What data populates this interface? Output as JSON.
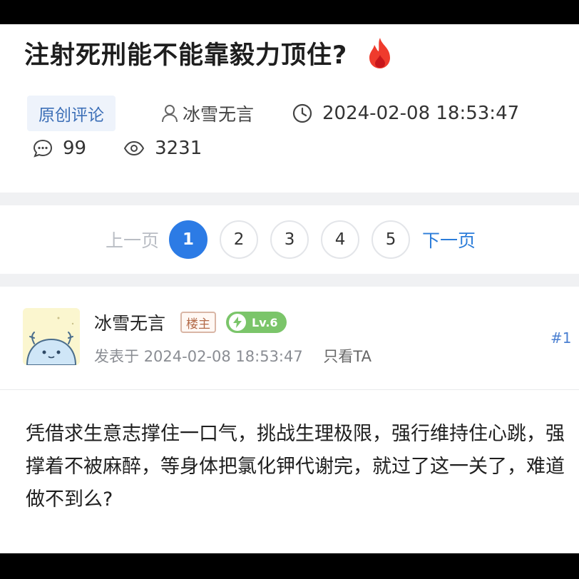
{
  "post": {
    "title": "注射死刑能不能靠毅力顶住?",
    "tag": "原创评论",
    "author": "冰雪无言",
    "datetime": "2024-02-08 18:53:47",
    "comments": "99",
    "views": "3231"
  },
  "pagination": {
    "prev_label": "上一页",
    "next_label": "下一页",
    "pages": [
      "1",
      "2",
      "3",
      "4",
      "5"
    ],
    "current": "1"
  },
  "reply": {
    "username": "冰雪无言",
    "owner_badge": "楼主",
    "level": "Lv.6",
    "posted_prefix": "发表于",
    "posted_time": "2024-02-08 18:53:47",
    "only_ta": "只看TA",
    "floor": "#1",
    "body": "凭借求生意志撑住一口气，挑战生理极限，强行维持住心跳，强撑着不被麻醉，等身体把氯化钾代谢完，就过了这一关了，难道做不到么?"
  },
  "colors": {
    "accent": "#2c7be5",
    "tag_bg": "#eef3fb",
    "level_badge": "#7bc56a",
    "fire": "#ef3b2d"
  },
  "icons": [
    "fire-icon",
    "user-icon",
    "clock-icon",
    "comment-icon",
    "eye-icon",
    "bolt-icon"
  ]
}
